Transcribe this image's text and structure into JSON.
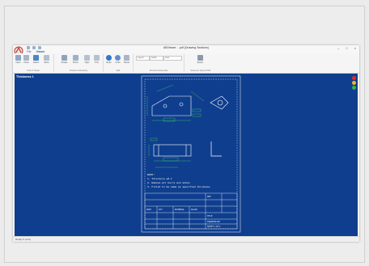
{
  "window": {
    "title": "ABViewer - .pdf (Drawing Sections)",
    "controls": [
      "–",
      "□",
      "×"
    ]
  },
  "tabs": [
    {
      "label": "File"
    },
    {
      "label": "Viewer"
    }
  ],
  "ribbon": {
    "groups": [
      {
        "label": "Tools & Setup"
      },
      {
        "label": "Position & Drawing"
      },
      {
        "label": "Edit"
      },
      {
        "label": "Structure Assembly"
      },
      {
        "label": "Save as / Export PDF"
      }
    ],
    "buttons": [
      {
        "label": "Open"
      },
      {
        "label": "Close"
      },
      {
        "label": "Select"
      },
      {
        "label": "Move"
      },
      {
        "label": "Rotate"
      },
      {
        "label": "Mirror"
      },
      {
        "label": "Align"
      },
      {
        "label": "Trim"
      },
      {
        "label": "Redo"
      },
      {
        "label": "Undo"
      },
      {
        "label": "Reset"
      },
      {
        "label": "Export"
      }
    ],
    "fields": [
      "Layout",
      "Scale",
      "Auto"
    ]
  },
  "canvas": {
    "title": "Thickness 1",
    "status_colors": {
      "red": "#e52b24",
      "yellow": "#f2b619",
      "green": "#34b44a"
    }
  },
  "drawing": {
    "note_lines": [
      "NOTE:",
      "1. Tolerance ±0.1",
      "2. Remove all burrs and sharp",
      "3. Finish to be same as specified thickness"
    ],
    "title_block": {
      "cells": [
        "PART",
        "QTY",
        "MATERIAL",
        "SCALE",
        "REV",
        "TITLE",
        "DRAWING NO",
        "SHEET 1 OF 1"
      ]
    }
  },
  "status": {
    "text": "Ready  0 entity"
  },
  "colors": {
    "canvas_bg": "#0f3e8e",
    "line": "#ffffff",
    "dimension": "#40d060"
  }
}
